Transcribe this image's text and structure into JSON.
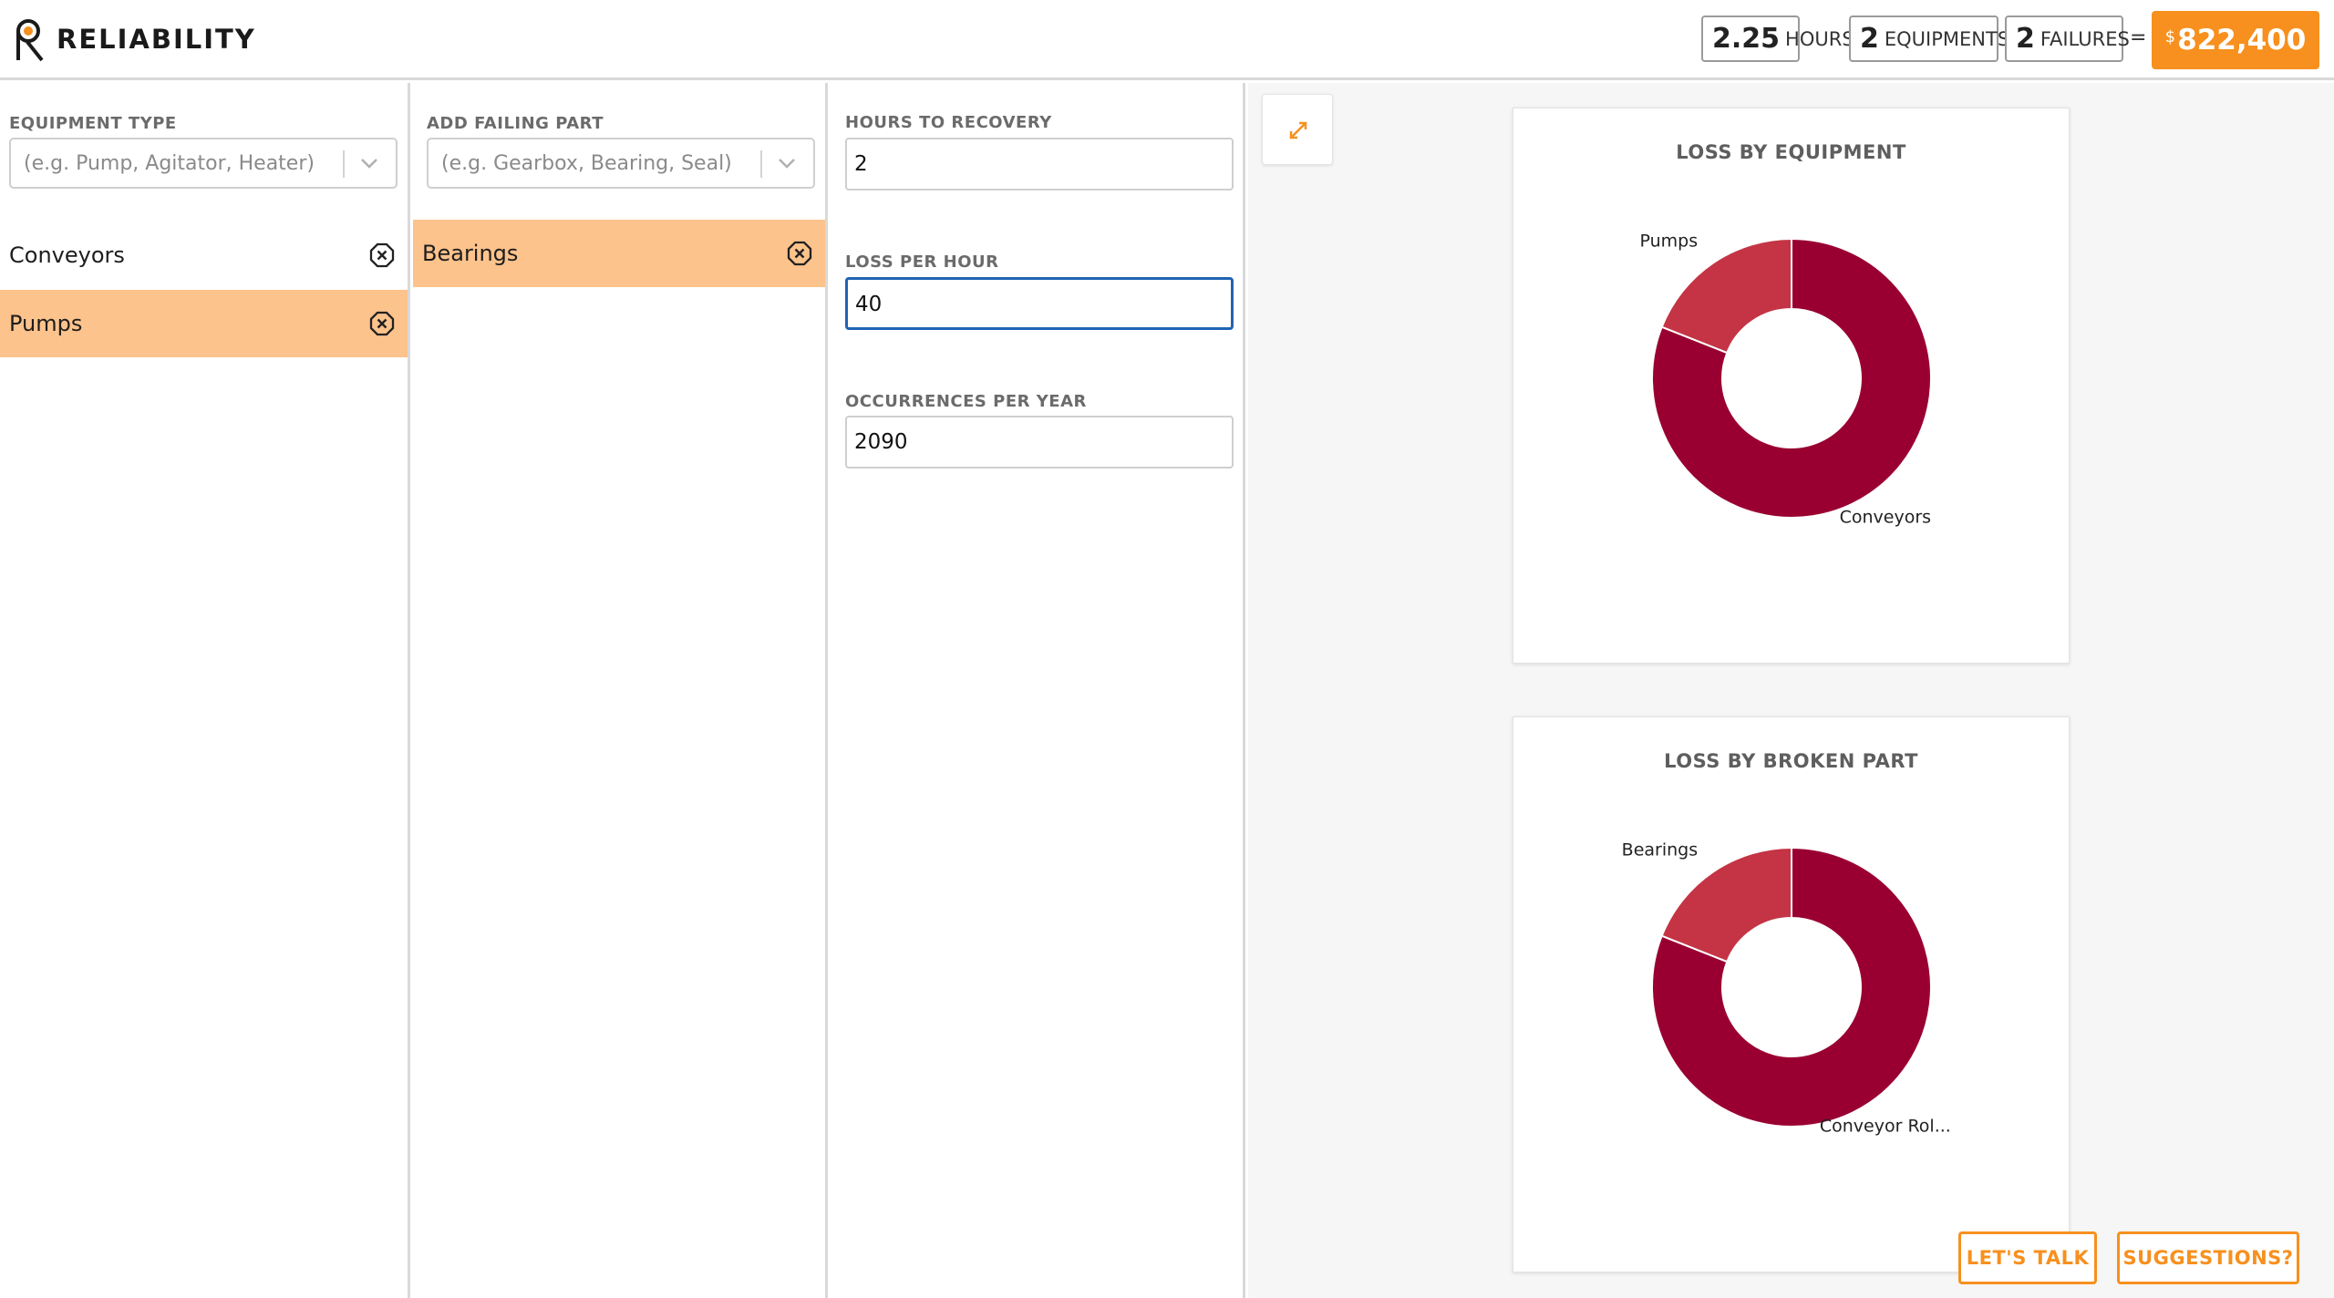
{
  "app": {
    "brand": "RELIABILITY"
  },
  "summary": {
    "hours_value": "2.25",
    "hours_unit": "HOURS",
    "equipments_value": "2",
    "equipments_unit": "EQUIPMENTS",
    "failures_value": "2",
    "failures_unit": "FAILURES",
    "equals": "=",
    "currency": "$",
    "total": "822,400"
  },
  "equipment": {
    "label": "EQUIPMENT TYPE",
    "placeholder": "(e.g. Pump, Agitator, Heater)",
    "items": [
      {
        "label": "Conveyors",
        "selected": false
      },
      {
        "label": "Pumps",
        "selected": true
      }
    ]
  },
  "parts": {
    "label": "ADD FAILING PART",
    "placeholder": "(e.g. Gearbox, Bearing, Seal)",
    "items": [
      {
        "label": "Bearings",
        "selected": true
      }
    ]
  },
  "details": {
    "hours_label": "HOURS TO RECOVERY",
    "hours_value": "2",
    "loss_label": "LOSS PER HOUR",
    "loss_value": "40",
    "occ_label": "OCCURRENCES PER YEAR",
    "occ_value": "2090"
  },
  "charts": {
    "equipment_title": "LOSS BY EQUIPMENT",
    "broken_title": "LOSS BY BROKEN PART"
  },
  "chart_data": [
    {
      "type": "pie",
      "title": "LOSS BY EQUIPMENT",
      "categories": [
        "Conveyors",
        "Pumps"
      ],
      "values": [
        81,
        19
      ]
    },
    {
      "type": "pie",
      "title": "LOSS BY BROKEN PART",
      "categories": [
        "Conveyor Rol...",
        "Bearings"
      ],
      "values": [
        81,
        19
      ]
    }
  ],
  "colors": {
    "accent": "#f7901e",
    "selected": "#fdc38c",
    "primary_slice": "#990031",
    "secondary_slice": "#c43444",
    "focus": "#1f63b4"
  },
  "footer": {
    "talk_label": "LET'S TALK",
    "suggest_label": "SUGGESTIONS?"
  }
}
